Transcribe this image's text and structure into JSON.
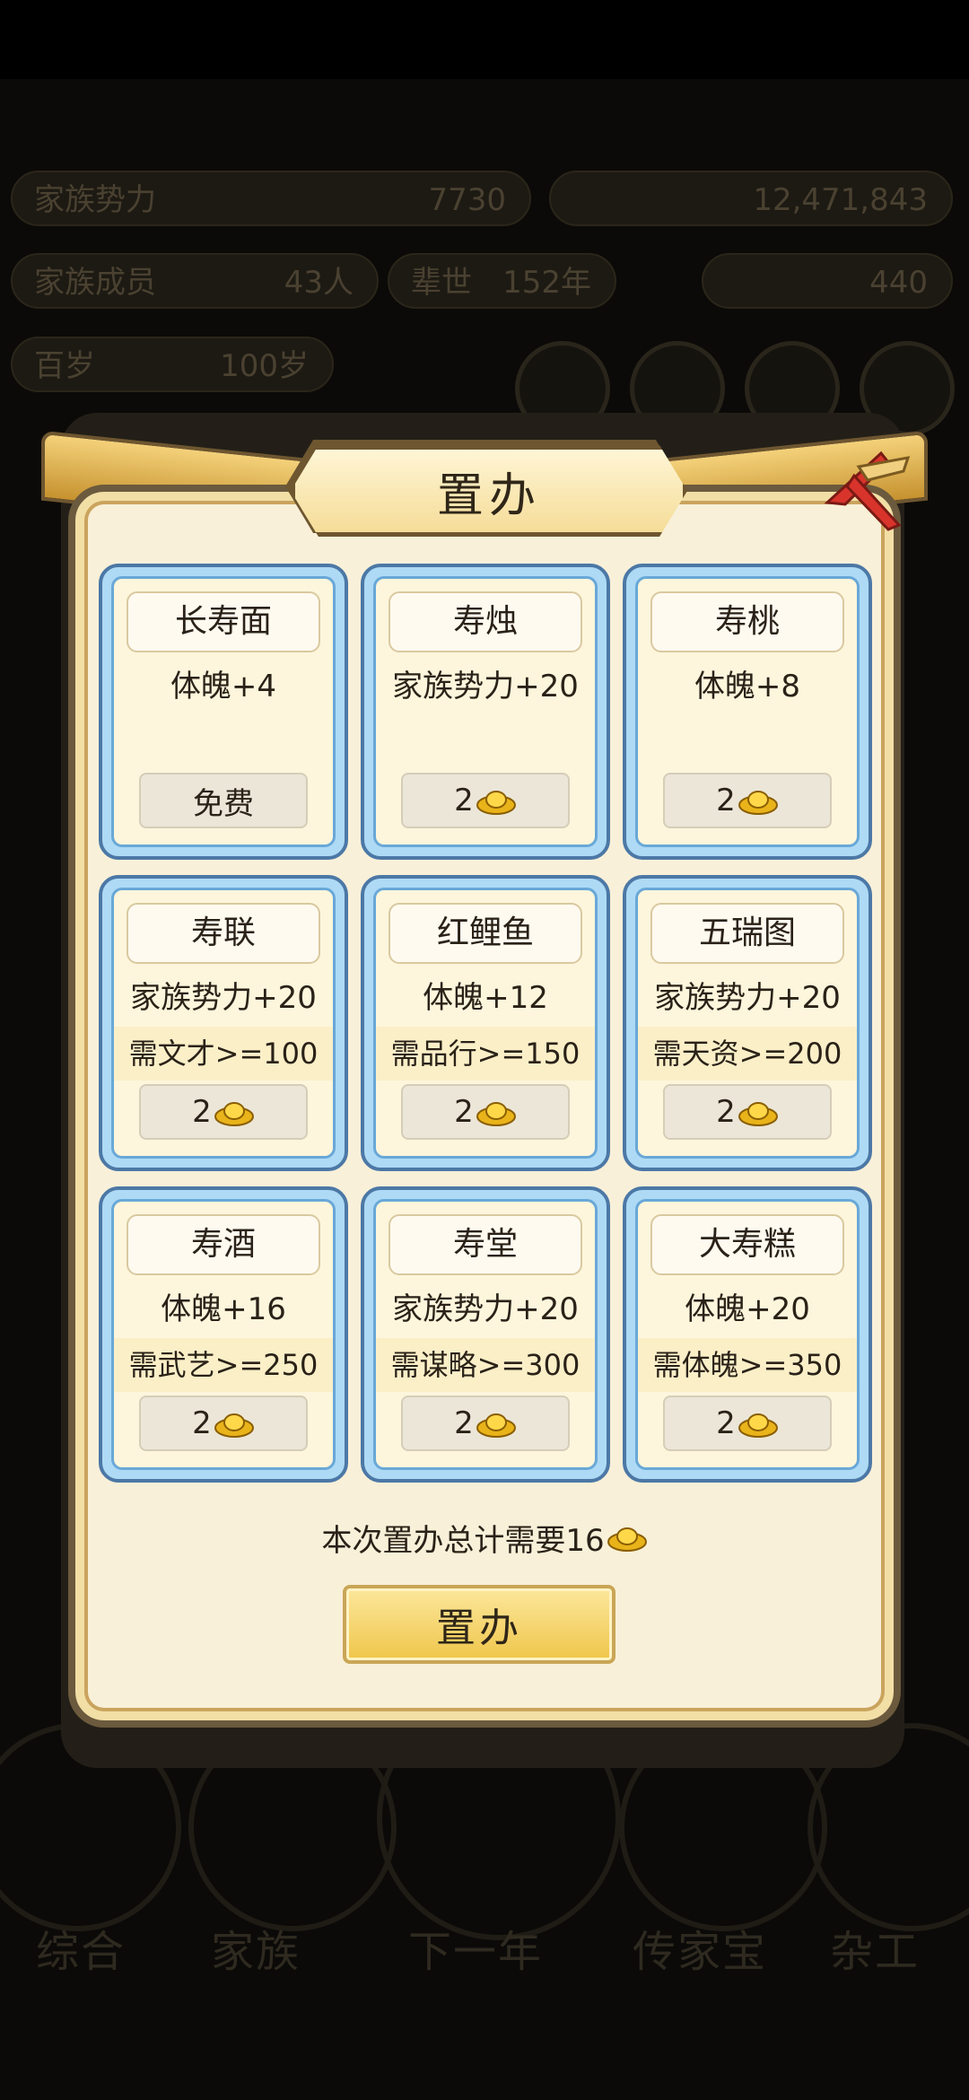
{
  "modal": {
    "title": "置办",
    "items": [
      {
        "name": "长寿面",
        "effect": "体魄+4",
        "requirement": "",
        "cost": "免费",
        "cost_icon": false
      },
      {
        "name": "寿烛",
        "effect": "家族势力+20",
        "requirement": "",
        "cost": "2",
        "cost_icon": true
      },
      {
        "name": "寿桃",
        "effect": "体魄+8",
        "requirement": "",
        "cost": "2",
        "cost_icon": true
      },
      {
        "name": "寿联",
        "effect": "家族势力+20",
        "requirement": "需文才>=100",
        "cost": "2",
        "cost_icon": true
      },
      {
        "name": "红鲤鱼",
        "effect": "体魄+12",
        "requirement": "需品行>=150",
        "cost": "2",
        "cost_icon": true
      },
      {
        "name": "五瑞图",
        "effect": "家族势力+20",
        "requirement": "需天资>=200",
        "cost": "2",
        "cost_icon": true
      },
      {
        "name": "寿酒",
        "effect": "体魄+16",
        "requirement": "需武艺>=250",
        "cost": "2",
        "cost_icon": true
      },
      {
        "name": "寿堂",
        "effect": "家族势力+20",
        "requirement": "需谋略>=300",
        "cost": "2",
        "cost_icon": true
      },
      {
        "name": "大寿糕",
        "effect": "体魄+20",
        "requirement": "需体魄>=350",
        "cost": "2",
        "cost_icon": true
      }
    ],
    "total_text": "本次置办总计需要16",
    "confirm_label": "置办"
  },
  "background": {
    "bars": [
      {
        "label": "家族势力",
        "value": "7730"
      },
      {
        "label": "",
        "value": "12,471,843"
      },
      {
        "label": "家族成员",
        "value": "43人"
      },
      {
        "label": "辈世",
        "value": "152年"
      },
      {
        "label": "",
        "value": "440"
      },
      {
        "label": "百岁",
        "value": "100岁"
      }
    ],
    "nav": [
      "综合",
      "家族",
      "下一年",
      "传家宝",
      "杂工"
    ]
  },
  "colors": {
    "card_border": "#4c78a6",
    "card_fill": "#aedaf5",
    "modal_fill": "#f9f0d9",
    "button_gold": "#f0c64a",
    "close_red": "#d8342c"
  }
}
